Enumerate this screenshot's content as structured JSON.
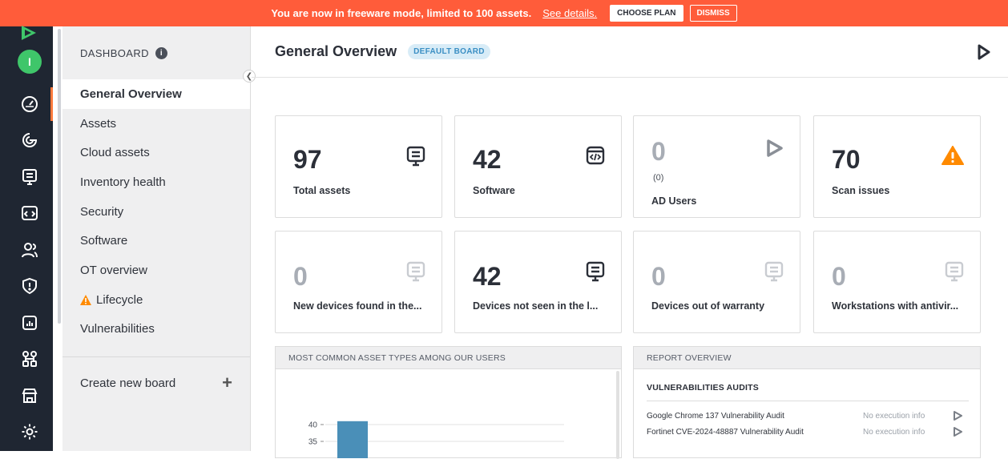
{
  "banner": {
    "message": "You are now in freeware mode, limited to 100 assets.",
    "details_link": "See details.",
    "choose_plan": "CHOOSE PLAN",
    "dismiss": "DISMISS"
  },
  "user": {
    "initial": "I"
  },
  "rail": {
    "icons": [
      "dashboard-icon",
      "scan-icon",
      "assets-icon",
      "software-icon",
      "users-icon",
      "security-icon",
      "reports-icon",
      "diagram-icon",
      "marketplace-icon",
      "settings-icon"
    ]
  },
  "sidebar": {
    "header": "DASHBOARD",
    "items": [
      {
        "label": "General Overview",
        "active": true
      },
      {
        "label": "Assets"
      },
      {
        "label": "Cloud assets"
      },
      {
        "label": "Inventory health"
      },
      {
        "label": "Security"
      },
      {
        "label": "Software"
      },
      {
        "label": "OT overview"
      },
      {
        "label": "Lifecycle",
        "warning": true
      },
      {
        "label": "Vulnerabilities"
      }
    ],
    "create_label": "Create new board",
    "create_icon": "+"
  },
  "main": {
    "title": "General Overview",
    "badge": "DEFAULT BOARD"
  },
  "cards": [
    {
      "value": "97",
      "label": "Total assets",
      "icon": "monitor-icon"
    },
    {
      "value": "42",
      "label": "Software",
      "icon": "code-window-icon"
    },
    {
      "value": "0",
      "sub": "(0)",
      "label": "AD Users",
      "icon": "play-icon"
    },
    {
      "value": "70",
      "label": "Scan issues",
      "icon": "warning-icon"
    },
    {
      "value": "0",
      "label": "New devices found in the...",
      "icon": "monitor-icon"
    },
    {
      "value": "42",
      "label": "Devices not seen in the l...",
      "icon": "monitor-icon"
    },
    {
      "value": "0",
      "label": "Devices out of warranty",
      "icon": "monitor-icon"
    },
    {
      "value": "0",
      "label": "Workstations with antivir...",
      "icon": "monitor-icon"
    }
  ],
  "asset_panel": {
    "title": "MOST COMMON ASSET TYPES AMONG OUR USERS"
  },
  "chart_data": {
    "type": "bar",
    "categories": [
      ""
    ],
    "values": [
      41
    ],
    "title": "",
    "xlabel": "",
    "ylabel": "",
    "yticks": [
      35,
      40
    ]
  },
  "report_panel": {
    "title": "REPORT OVERVIEW",
    "section": "VULNERABILITIES AUDITS",
    "audits": [
      {
        "name": "Google Chrome 137 Vulnerability Audit",
        "status": "No execution info"
      },
      {
        "name": "Fortinet CVE-2024-48887 Vulnerability Audit",
        "status": "No execution info"
      }
    ]
  },
  "colors": {
    "banner": "#ff5c3a",
    "rail": "#1f2632",
    "accent_green": "#3fc66a",
    "warning": "#ff8a00",
    "bar": "#4a8fb8"
  }
}
